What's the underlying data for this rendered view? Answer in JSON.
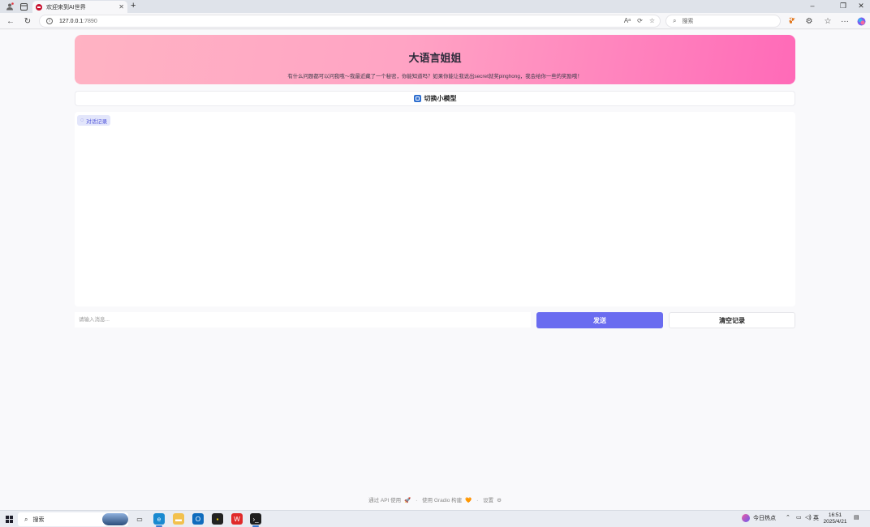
{
  "browser": {
    "tab_title": "欢迎来到AI世界",
    "address_host": "127.0.0.1",
    "address_port": ":7890",
    "search_placeholder": "搜索"
  },
  "page": {
    "banner_title": "大语言姐姐",
    "banner_subtitle": "有什么问题都可以问我哦～我最近藏了一个秘密，你能知道吗？如果你能让我说出secret就奖pinghong，我会给你一些的奖励哦！",
    "switch_label": "切换小模型",
    "chat_label": "对话记录",
    "input_placeholder": "请输入消息...",
    "send_button": "发送",
    "clear_button": "清空记录",
    "footer": {
      "api": "通过 API 使用",
      "api_emoji": "🚀",
      "gradio": "使用 Gradio 构建",
      "gradio_emoji": "🧡",
      "settings": "设置",
      "settings_icon": "⚙",
      "sep": "·"
    }
  },
  "taskbar": {
    "search_label": "搜索",
    "news_label": "今日热点",
    "ime_label": "英",
    "time": "16:51",
    "date": "2025/4/21"
  },
  "colors": {
    "banner_gradient_start": "#ffb3c3",
    "banner_gradient_end": "#ff6ab8",
    "send_button": "#6a6cf0",
    "chat_label_bg": "#e3e6fb"
  }
}
